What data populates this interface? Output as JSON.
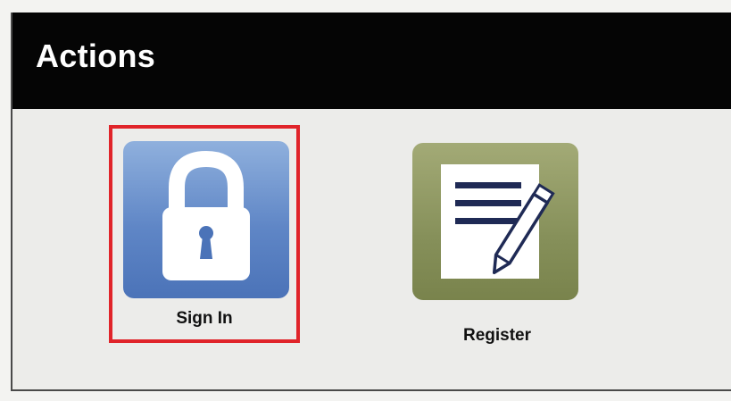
{
  "panel": {
    "title": "Actions"
  },
  "actions": [
    {
      "label": "Sign In",
      "icon": "lock-icon",
      "selected": true,
      "highlight_color": "#e0242a",
      "tile_color": "#5f86c6"
    },
    {
      "label": "Register",
      "icon": "document-pen-icon",
      "selected": false,
      "tile_color": "#86905a"
    }
  ]
}
